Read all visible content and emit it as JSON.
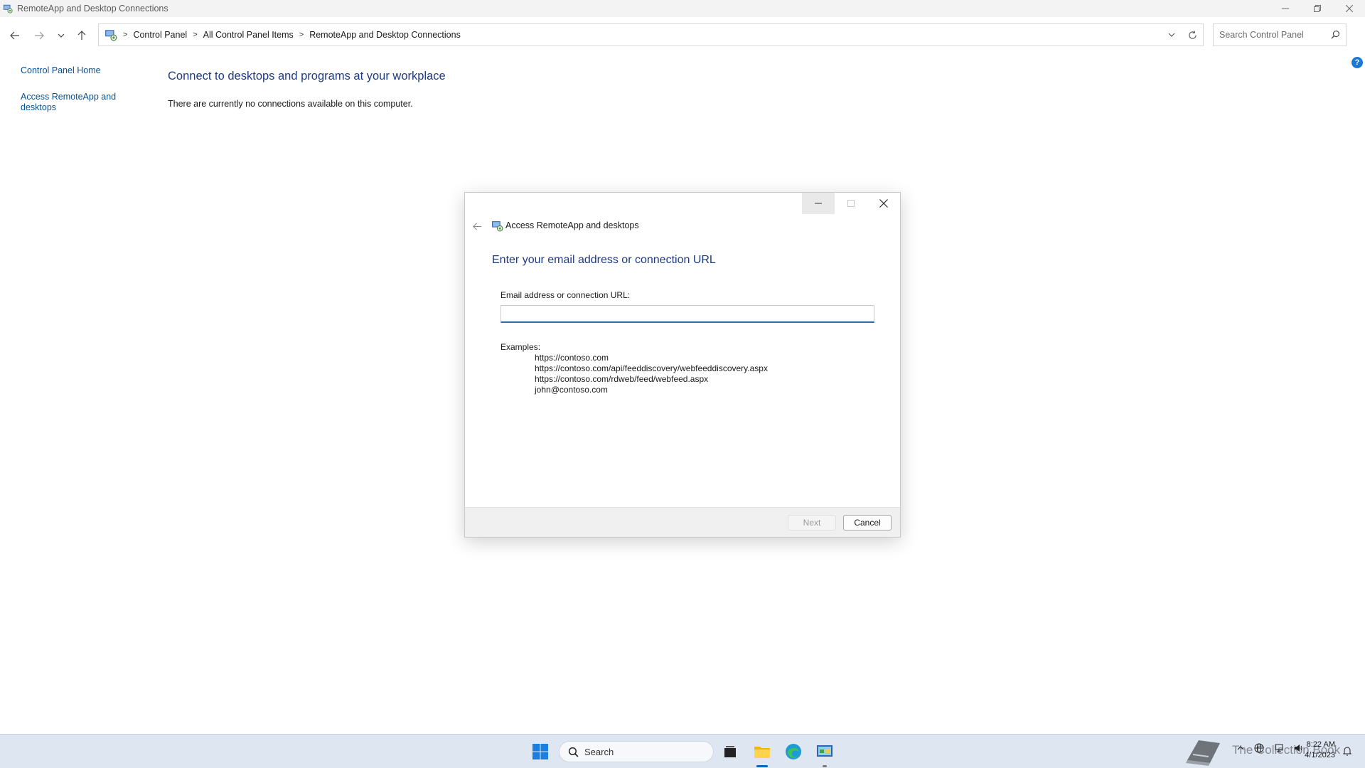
{
  "window": {
    "title": "RemoteApp and Desktop Connections"
  },
  "address_bar": {
    "crumbs": [
      "Control Panel",
      "All Control Panel Items",
      "RemoteApp and Desktop Connections"
    ],
    "search_placeholder": "Search Control Panel"
  },
  "left_nav": {
    "home": "Control Panel Home",
    "access": "Access RemoteApp and desktops"
  },
  "main": {
    "heading": "Connect to desktops and programs at your workplace",
    "text": "There are currently no connections available on this computer."
  },
  "dialog": {
    "title": "Access RemoteApp and desktops",
    "heading": "Enter your email address or connection URL",
    "field_label": "Email address or connection URL:",
    "field_value": "",
    "examples_label": "Examples:",
    "examples": [
      "https://contoso.com",
      "https://contoso.com/api/feeddiscovery/webfeeddiscovery.aspx",
      "https://contoso.com/rdweb/feed/webfeed.aspx",
      "john@contoso.com"
    ],
    "next_label": "Next",
    "cancel_label": "Cancel"
  },
  "taskbar": {
    "search_label": "Search",
    "watermark": "The Collection Book",
    "time": "8:22 AM",
    "date": "4/1/2023"
  },
  "colors": {
    "heading_blue": "#1e3a82",
    "link_blue": "#0b4f8f",
    "accent": "#2a6db5",
    "taskbar_bg": "#dde6f1"
  },
  "icons": [
    "app-icon",
    "minimize-icon",
    "restore-icon",
    "close-icon",
    "back-arrow-icon",
    "forward-arrow-icon",
    "recent-locations-icon",
    "up-arrow-icon",
    "location-icon",
    "dropdown-icon",
    "refresh-icon",
    "search-icon",
    "help-icon",
    "start-icon",
    "task-view-icon",
    "file-explorer-icon",
    "edge-icon",
    "control-panel-icon",
    "book-icon",
    "language-icon",
    "network-icon",
    "volume-icon",
    "notification-icon"
  ]
}
